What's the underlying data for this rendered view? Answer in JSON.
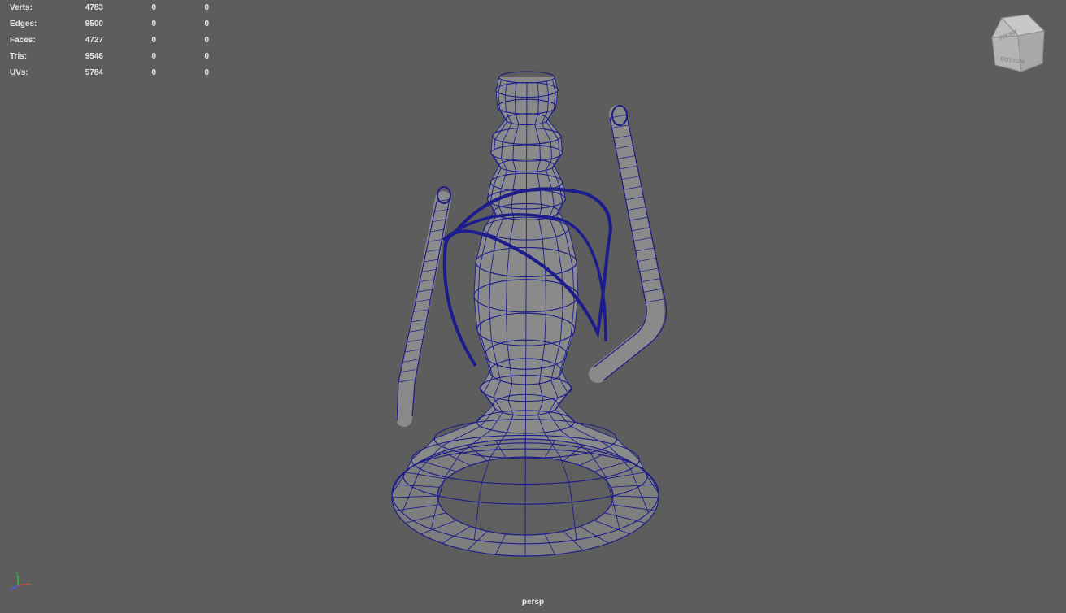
{
  "heads_up_display": {
    "rows": [
      {
        "label": "Verts:",
        "values": [
          "4783",
          "0",
          "0"
        ]
      },
      {
        "label": "Edges:",
        "values": [
          "9500",
          "0",
          "0"
        ]
      },
      {
        "label": "Faces:",
        "values": [
          "4727",
          "0",
          "0"
        ]
      },
      {
        "label": "Tris:",
        "values": [
          "9546",
          "0",
          "0"
        ]
      },
      {
        "label": "UVs:",
        "values": [
          "5784",
          "0",
          "0"
        ]
      }
    ]
  },
  "view_cube": {
    "face_front": "FRONT",
    "face_bottom": "BOTTOM"
  },
  "axis_indicator": {
    "y_label": "Y"
  },
  "viewport": {
    "camera": "persp",
    "background": "#5d5d5d",
    "wire_color": "#1c1c8c",
    "shade_color": "#8a8a8a"
  }
}
